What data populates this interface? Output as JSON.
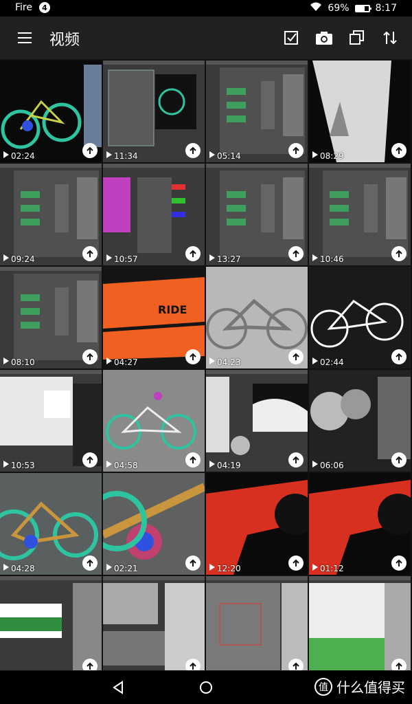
{
  "status_bar": {
    "carrier": "Fire",
    "notification_count": "4",
    "battery_percent": "69%",
    "battery_level": 0.69,
    "time": "8:17"
  },
  "app_bar": {
    "title": "视频",
    "actions": [
      "select-icon",
      "camera-icon",
      "copy-icon",
      "sort-icon"
    ]
  },
  "videos": [
    {
      "duration": "02:24",
      "theme": "bike-wire"
    },
    {
      "duration": "11:34",
      "theme": "ui-dialog"
    },
    {
      "duration": "05:14",
      "theme": "ui-nodes"
    },
    {
      "duration": "08:29",
      "theme": "fabric"
    },
    {
      "duration": "09:24",
      "theme": "ui-nodes"
    },
    {
      "duration": "10:57",
      "theme": "ui-color"
    },
    {
      "duration": "13:27",
      "theme": "ui-nodes"
    },
    {
      "duration": "10:46",
      "theme": "ui-nodes"
    },
    {
      "duration": "08:10",
      "theme": "ui-nodes"
    },
    {
      "duration": "04:27",
      "theme": "orange-print"
    },
    {
      "duration": "04:23",
      "theme": "bike-grey"
    },
    {
      "duration": "02:44",
      "theme": "bike-white"
    },
    {
      "duration": "10:53",
      "theme": "ui-dialog-light"
    },
    {
      "duration": "04:58",
      "theme": "bike-grey-wire"
    },
    {
      "duration": "04:19",
      "theme": "ui-curve"
    },
    {
      "duration": "06:06",
      "theme": "spheres"
    },
    {
      "duration": "04:28",
      "theme": "bike-gold"
    },
    {
      "duration": "02:21",
      "theme": "bike-gold-close"
    },
    {
      "duration": "12:20",
      "theme": "red-frame"
    },
    {
      "duration": "01:12",
      "theme": "red-frame"
    },
    {
      "duration": "",
      "theme": "ui-green"
    },
    {
      "duration": "",
      "theme": "ui-sofa"
    },
    {
      "duration": "",
      "theme": "ui-grid"
    },
    {
      "duration": "",
      "theme": "ui-cushion"
    }
  ],
  "watermark": {
    "logo": "值",
    "text": "什么值得买"
  },
  "colors": {
    "app_bar": "#212121",
    "status_bar": "#000000",
    "background": "#111111"
  }
}
